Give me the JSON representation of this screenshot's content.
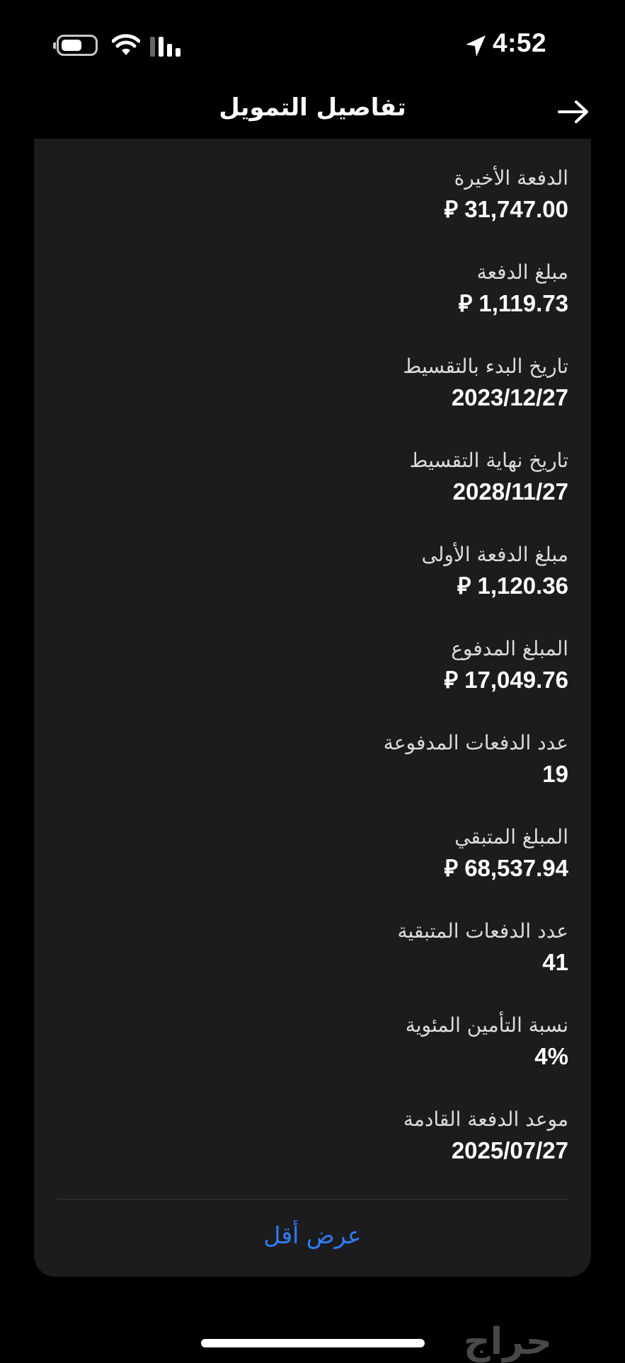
{
  "status_bar": {
    "time": "4:52",
    "icons": [
      "battery-icon",
      "wifi-icon",
      "signal-icon",
      "location-arrow-icon"
    ]
  },
  "header": {
    "title": "تفاصيل التمويل",
    "back_icon": "arrow-right-icon"
  },
  "details": [
    {
      "label": "الدفعة الأخيرة",
      "value": "31,747.00",
      "currency": "⃁"
    },
    {
      "label": "مبلغ الدفعة",
      "value": "1,119.73",
      "currency": "⃁"
    },
    {
      "label": "تاريخ البدء بالتقسيط",
      "value": "2023/12/27"
    },
    {
      "label": "تاريخ نهاية التقسيط",
      "value": "2028/11/27"
    },
    {
      "label": "مبلغ الدفعة الأولى",
      "value": "1,120.36",
      "currency": "⃁"
    },
    {
      "label": "المبلغ المدفوع",
      "value": "17,049.76",
      "currency": "⃁"
    },
    {
      "label": "عدد الدفعات المدفوعة",
      "value": "19"
    },
    {
      "label": "المبلغ المتبقي",
      "value": "68,537.94",
      "currency": "⃁"
    },
    {
      "label": "عدد الدفعات المتبقية",
      "value": "41"
    },
    {
      "label": "نسبة التأمين المئوية",
      "value": "4%"
    },
    {
      "label": "موعد الدفعة القادمة",
      "value": "2025/07/27"
    }
  ],
  "show_less_label": "عرض أقل",
  "watermark": "حراج",
  "colors": {
    "background": "#000000",
    "card": "#1c1c1e",
    "link": "#2f7cf6"
  }
}
